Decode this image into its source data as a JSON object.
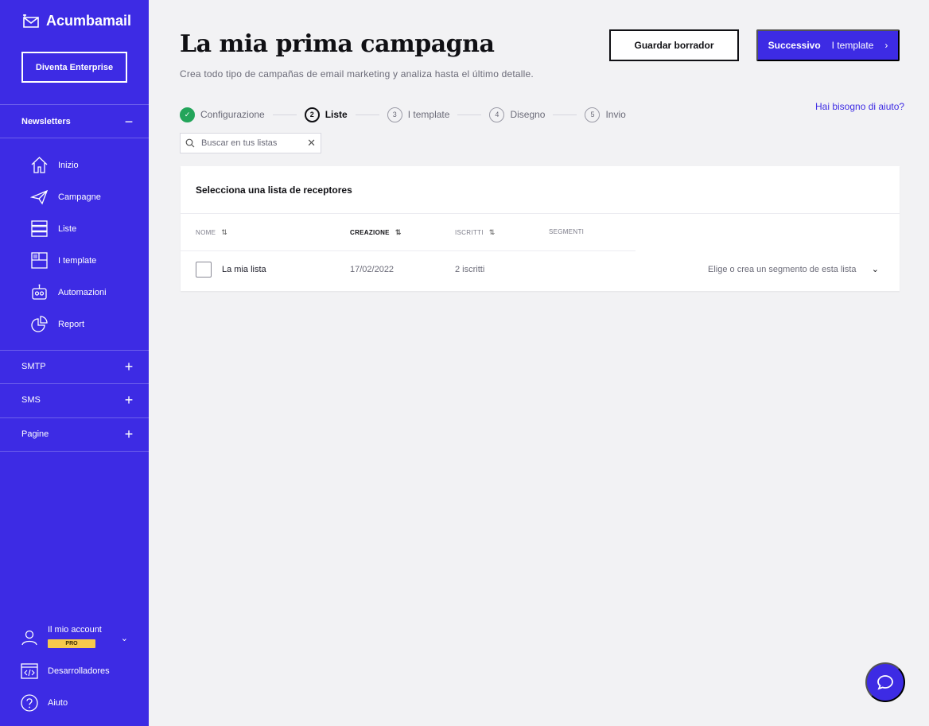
{
  "brand": {
    "name": "Acumbamail",
    "accent": "#3d2be4",
    "success": "#23a55a",
    "badge": "#f7c94b"
  },
  "sidebar": {
    "enterprise_button": "Diventa Enterprise",
    "sections": [
      {
        "label": "Newsletters",
        "toggle": "−",
        "expanded": true
      },
      {
        "label": "SMTP",
        "toggle": "+"
      },
      {
        "label": "SMS",
        "toggle": "+"
      },
      {
        "label": "Pagine",
        "toggle": "+"
      }
    ],
    "items": [
      {
        "label": "Inizio",
        "icon": "home-icon"
      },
      {
        "label": "Campagne",
        "icon": "paper-plane-icon"
      },
      {
        "label": "Liste",
        "icon": "list-icon"
      },
      {
        "label": "I template",
        "icon": "template-icon"
      },
      {
        "label": "Automazioni",
        "icon": "robot-icon"
      },
      {
        "label": "Report",
        "icon": "chart-icon"
      }
    ],
    "account": {
      "label": "Il mio account",
      "badge": "PRO"
    },
    "bottom": [
      {
        "label": "Desarrolladores",
        "icon": "code-icon"
      },
      {
        "label": "Aiuto",
        "icon": "help-icon"
      }
    ]
  },
  "header": {
    "title": "La mia prima campagna",
    "subtitle": "Crea todo tipo de campañas de email marketing y analiza hasta el último detalle.",
    "draft_button": "Guardar borrador",
    "next_button_bold": "Successivo",
    "next_button_label": "I template",
    "help_link": "Hai bisogno di aiuto?"
  },
  "stepper": {
    "steps": [
      {
        "num": "✓",
        "label": "Configurazione",
        "state": "done"
      },
      {
        "num": "2",
        "label": "Liste",
        "state": "active"
      },
      {
        "num": "3",
        "label": "I template",
        "state": "pending"
      },
      {
        "num": "4",
        "label": "Disegno",
        "state": "pending"
      },
      {
        "num": "5",
        "label": "Invio",
        "state": "pending"
      }
    ]
  },
  "search": {
    "placeholder": "Buscar en tus listas",
    "value": ""
  },
  "lists_card": {
    "title": "Selecciona una lista de receptores",
    "columns": [
      "NOME",
      "CREAZIONE",
      "ISCRITTI",
      "SEGMENTI"
    ],
    "rows": [
      {
        "name": "La mia lista",
        "created": "17/02/2022",
        "subscribers": "2 iscritti",
        "segment_placeholder": "Elige o crea un segmento de esta lista"
      }
    ]
  }
}
